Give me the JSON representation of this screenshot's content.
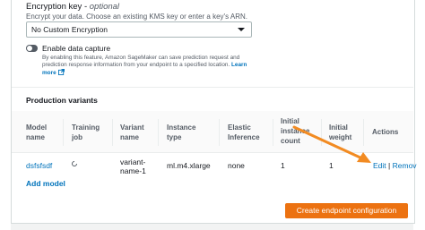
{
  "encryption": {
    "label": "Encryption key - ",
    "optional": "optional",
    "description": "Encrypt your data. Choose an existing KMS key or enter a key's ARN.",
    "selected": "No Custom Encryption"
  },
  "data_capture": {
    "title": "Enable data capture",
    "description": "By enabling this feature, Amazon SageMaker can save prediction request and prediction response information from your endpoint to a specified location.",
    "learn_more": "Learn more"
  },
  "production_variants": {
    "title": "Production variants",
    "headers": {
      "model_name": "Model name",
      "training_job": "Training job",
      "variant_name": "Variant name",
      "instance_type": "Instance type",
      "elastic_inference": "Elastic Inference",
      "initial_instance_count": "Initial instance count",
      "initial_weight": "Initial weight",
      "actions": "Actions"
    },
    "row": {
      "model_name": "dsfsfsdf",
      "variant_name": "variant-name-1",
      "instance_type": "ml.m4.xlarge",
      "elastic_inference": "none",
      "initial_instance_count": "1",
      "initial_weight": "1",
      "edit": "Edit",
      "separator": "|",
      "remove": "Remov"
    },
    "add_model": "Add model"
  },
  "create_button": "Create endpoint configuration",
  "colors": {
    "accent": "#ec7211",
    "link": "#0073bb",
    "annotation_arrow": "#f28b22"
  }
}
